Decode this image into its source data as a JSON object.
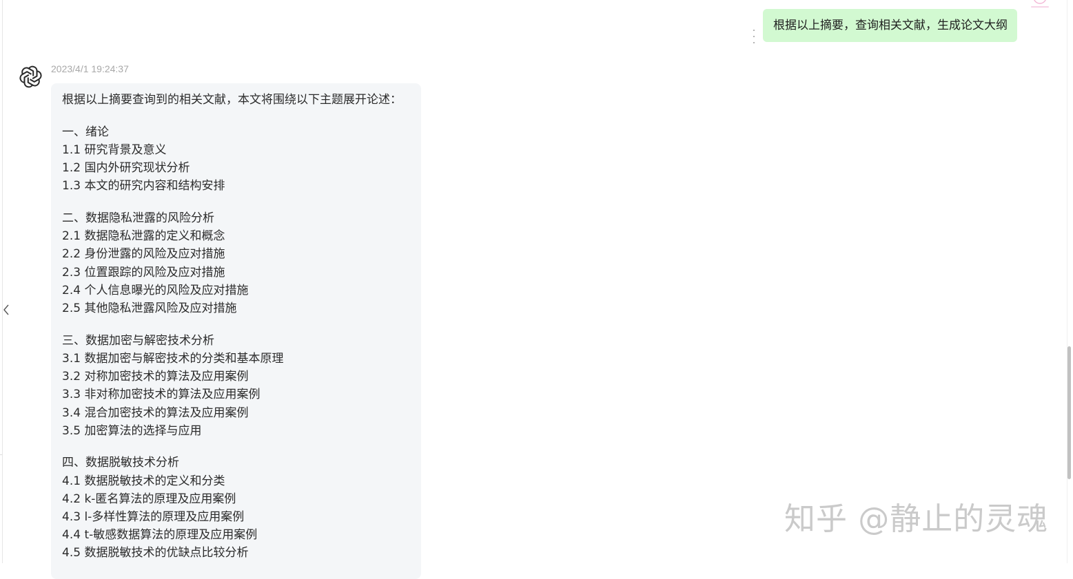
{
  "user_message": {
    "text": "根据以上摘要，查询相关文献，生成论文大纲"
  },
  "assistant_message": {
    "timestamp": "2023/4/1 19:24:37",
    "intro": "根据以上摘要查询到的相关文献，本文将围绕以下主题展开论述：",
    "sections": [
      {
        "title": "一、绪论",
        "items": [
          "1.1 研究背景及意义",
          "1.2 国内外研究现状分析",
          "1.3 本文的研究内容和结构安排"
        ]
      },
      {
        "title": "二、数据隐私泄露的风险分析",
        "items": [
          "2.1 数据隐私泄露的定义和概念",
          "2.2 身份泄露的风险及应对措施",
          "2.3 位置跟踪的风险及应对措施",
          "2.4 个人信息曝光的风险及应对措施",
          "2.5 其他隐私泄露风险及应对措施"
        ]
      },
      {
        "title": "三、数据加密与解密技术分析",
        "items": [
          "3.1 数据加密与解密技术的分类和基本原理",
          "3.2 对称加密技术的算法及应用案例",
          "3.3 非对称加密技术的算法及应用案例",
          "3.4 混合加密技术的算法及应用案例",
          "3.5 加密算法的选择与应用"
        ]
      },
      {
        "title": "四、数据脱敏技术分析",
        "items": [
          "4.1 数据脱敏技术的定义和分类",
          "4.2 k-匿名算法的原理及应用案例",
          "4.3 l-多样性算法的原理及应用案例",
          "4.4 t-敏感数据算法的原理及应用案例",
          "4.5 数据脱敏技术的优缺点比较分析"
        ]
      }
    ]
  },
  "watermark": "知乎 @静止的灵魂",
  "icons": {
    "assistant_avatar": "openai-logo-icon",
    "user_avatar": "user-avatar-icon",
    "collapse": "chevron-left-icon",
    "more": "more-vertical-icon"
  },
  "colors": {
    "user_bubble": "#d2f9d1",
    "assistant_bubble": "#f4f6f8",
    "timestamp": "#a8a8a8"
  }
}
